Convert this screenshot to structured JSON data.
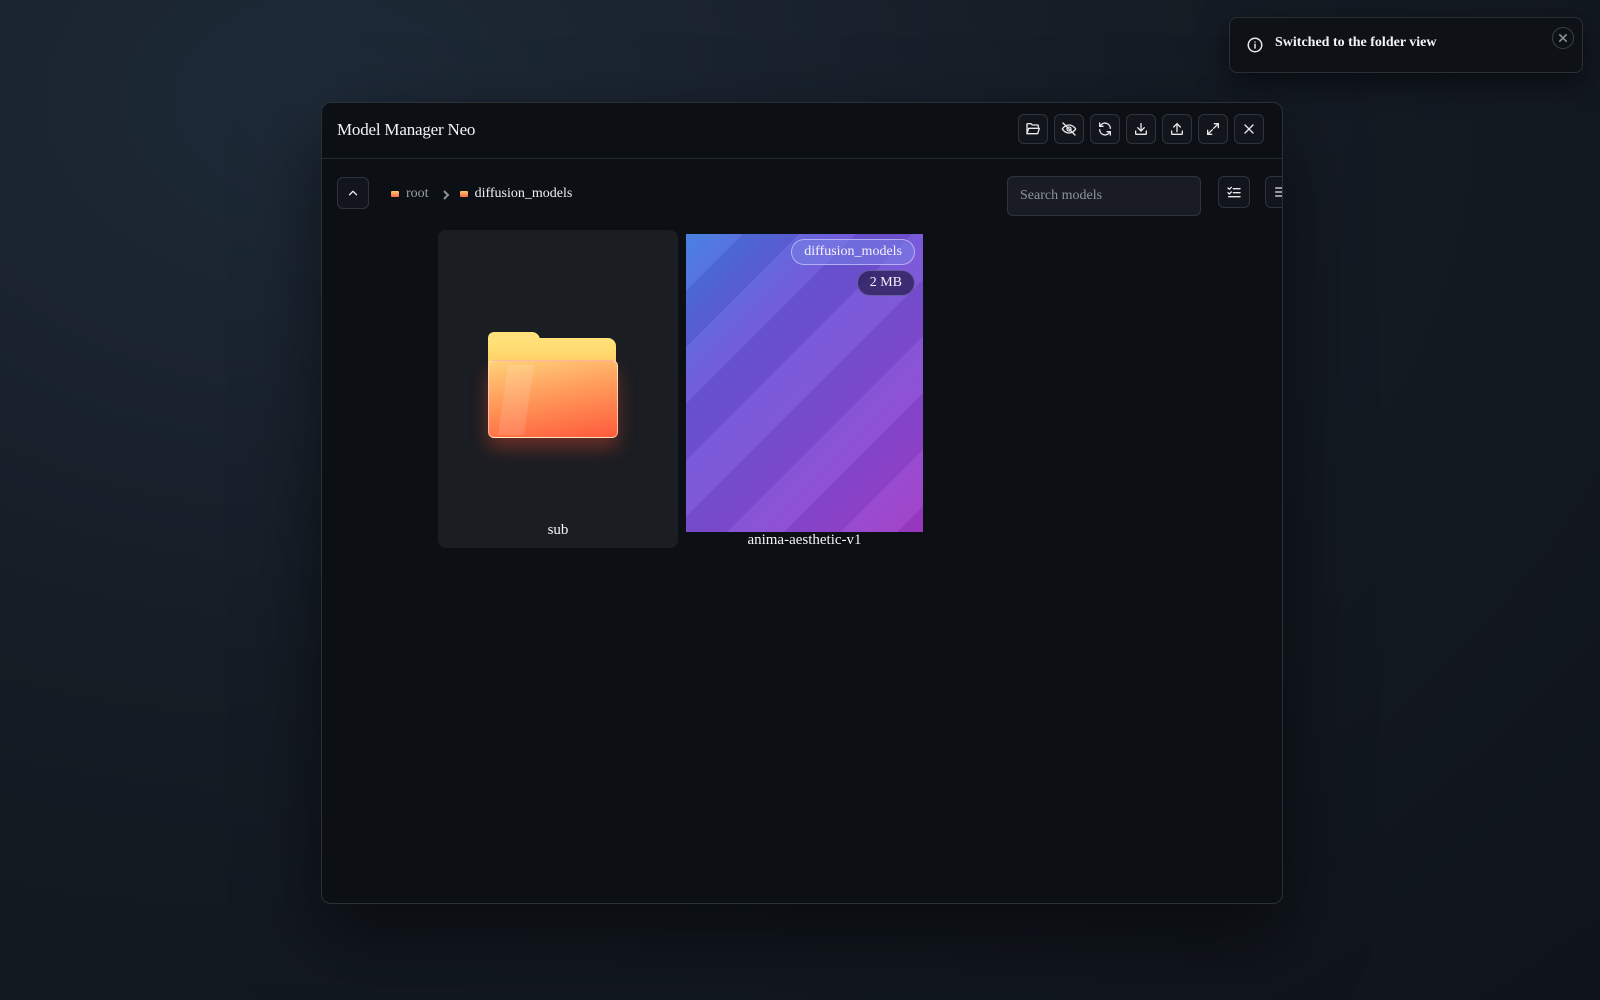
{
  "app": {
    "title": "Model Manager Neo"
  },
  "header_buttons": [
    {
      "icon": "folder-open-icon",
      "name": "open-folder-button"
    },
    {
      "icon": "eye-off-icon",
      "name": "hide-button"
    },
    {
      "icon": "refresh-icon",
      "name": "refresh-button"
    },
    {
      "icon": "download-icon",
      "name": "download-button"
    },
    {
      "icon": "upload-icon",
      "name": "upload-button"
    },
    {
      "icon": "maximize-icon",
      "name": "maximize-button"
    },
    {
      "icon": "close-icon",
      "name": "close-button"
    }
  ],
  "breadcrumb": {
    "items": [
      "root",
      "diffusion_models"
    ]
  },
  "search": {
    "placeholder": "Search models",
    "value": ""
  },
  "toolbar_buttons": [
    {
      "icon": "list-check-icon",
      "name": "select-mode-button"
    },
    {
      "icon": "list-view-icon",
      "name": "list-view-button"
    }
  ],
  "items": {
    "folder": {
      "label": "sub"
    },
    "model": {
      "label": "anima-aesthetic-v1",
      "folder_badge": "diffusion_models",
      "size_badge": "2 MB"
    }
  },
  "toast": {
    "message": "Switched to the folder view"
  },
  "colors": {
    "background": "#151c25",
    "modal": "#0c1015",
    "card": "#1a1d22",
    "accent_gradient_start": "#3f7ae0",
    "accent_gradient_end": "#a038c4"
  }
}
